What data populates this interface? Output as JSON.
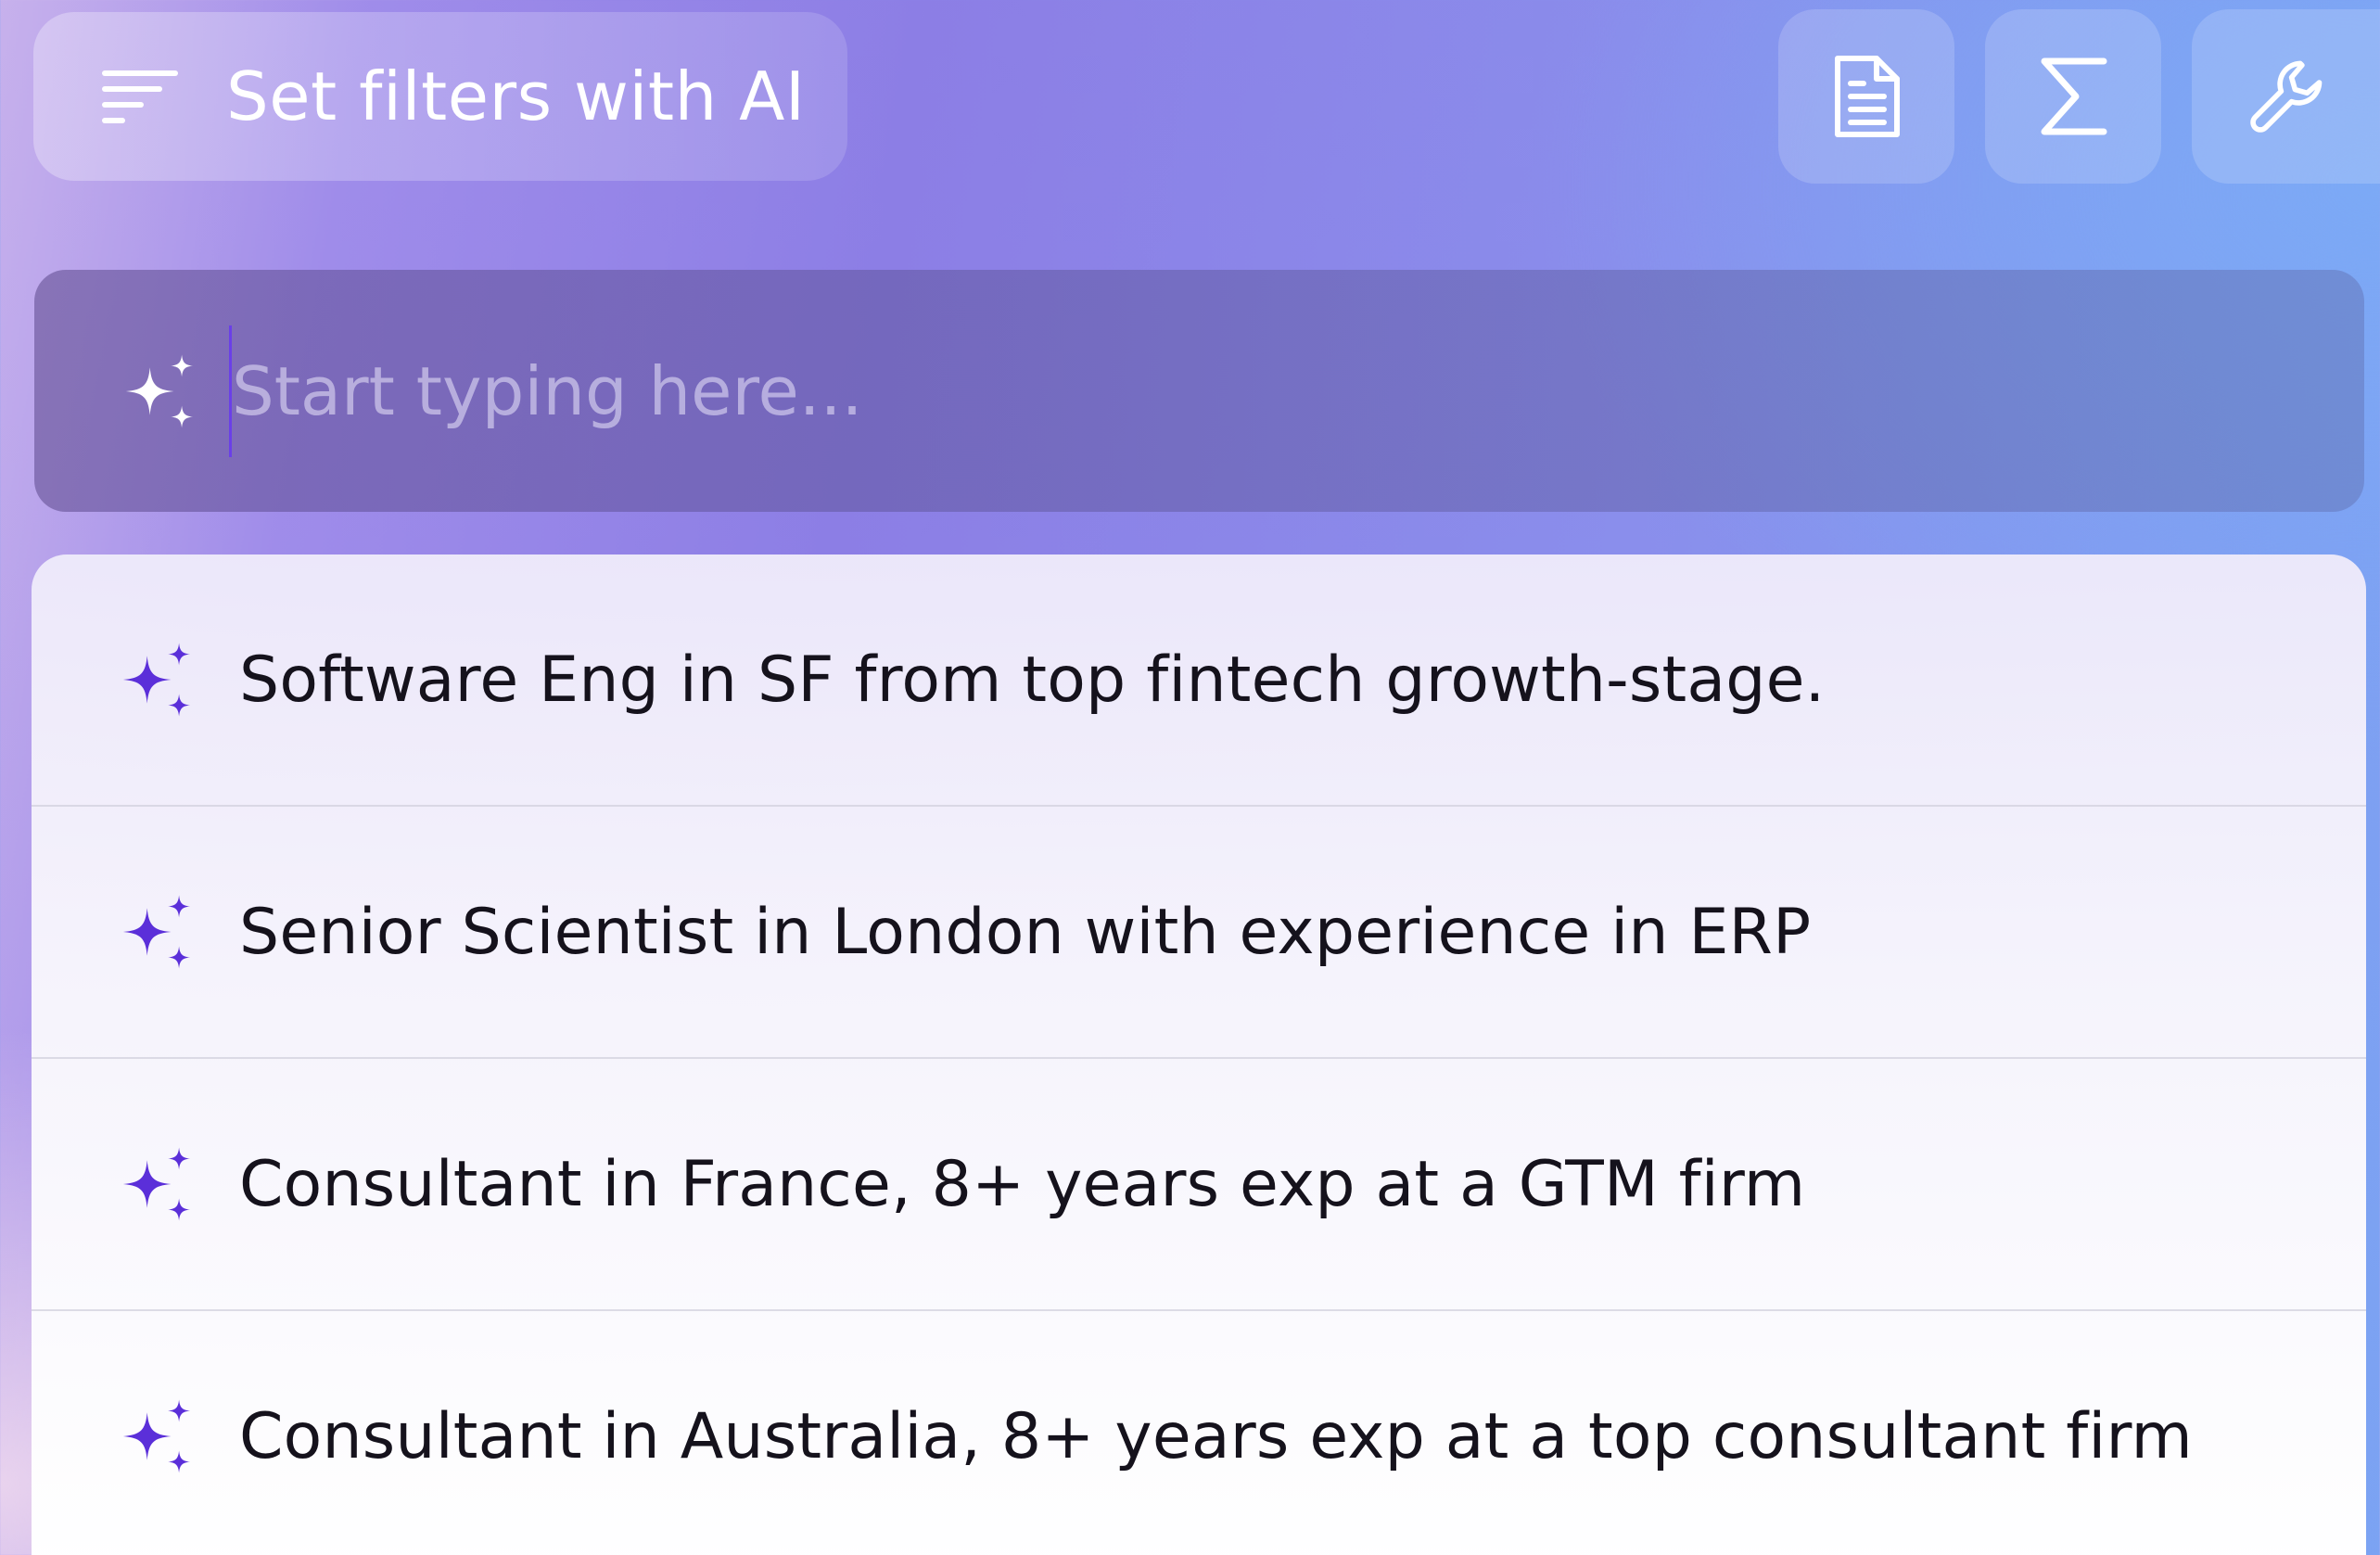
{
  "header": {
    "ai_filter_label": "Set filters with AI",
    "ai_filter_icon": "filter-lines-icon",
    "tools": [
      {
        "icon": "document-icon"
      },
      {
        "icon": "sigma-icon"
      },
      {
        "icon": "wrench-icon"
      }
    ]
  },
  "search": {
    "placeholder": "Start typing here...",
    "value": "",
    "icon": "sparkle-icon"
  },
  "suggestions": [
    {
      "text": "Software Eng in SF from top fintech growth-stage.",
      "icon": "sparkle-icon"
    },
    {
      "text": "Senior Scientist in London with experience in ERP",
      "icon": "sparkle-icon"
    },
    {
      "text": "Consultant in France, 8+ years exp at a GTM firm",
      "icon": "sparkle-icon"
    },
    {
      "text": "Consultant in Australia, 8+ years exp at a top consultant firm",
      "icon": "sparkle-icon"
    }
  ],
  "colors": {
    "accent_purple": "#6a3fe8",
    "sparkle_purple": "#5b2fd9",
    "text_dark": "#15121c",
    "header_white": "#ffffff"
  }
}
